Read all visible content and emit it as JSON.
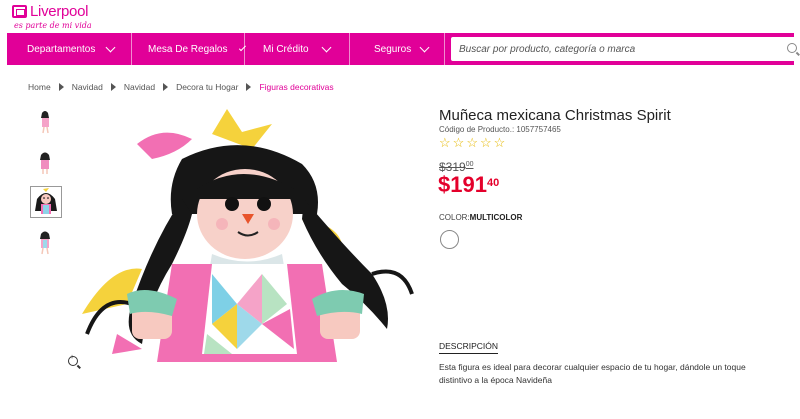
{
  "brand": {
    "name": "Liverpool",
    "tagline": "es parte de mi vida"
  },
  "nav": {
    "items": [
      {
        "label": "Departamentos"
      },
      {
        "label": "Mesa De Regalos"
      },
      {
        "label": "Mi Crédito"
      },
      {
        "label": "Seguros"
      }
    ],
    "search_placeholder": "Buscar por producto, categoría o marca"
  },
  "breadcrumb": [
    "Home",
    "Navidad",
    "Navidad",
    "Decora tu Hogar",
    "Figuras decorativas"
  ],
  "product": {
    "title": "Muñeca mexicana Christmas Spirit",
    "code": "Código de Producto.: 1057757465",
    "rating_stars": 5,
    "old_price_main": "$319",
    "old_price_cents": "00",
    "price_main": "$191",
    "price_cents": "40",
    "color_label": "COLOR:",
    "color_value": "MULTICOLOR",
    "description_title": "DESCRIPCIÓN",
    "description": "Esta figura es ideal para decorar cualquier espacio de tu hogar, dándole un toque distintivo a la época Navideña"
  },
  "colors": {
    "brand_pink": "#e10098",
    "price_red": "#e4002b",
    "star": "#e6b800"
  }
}
